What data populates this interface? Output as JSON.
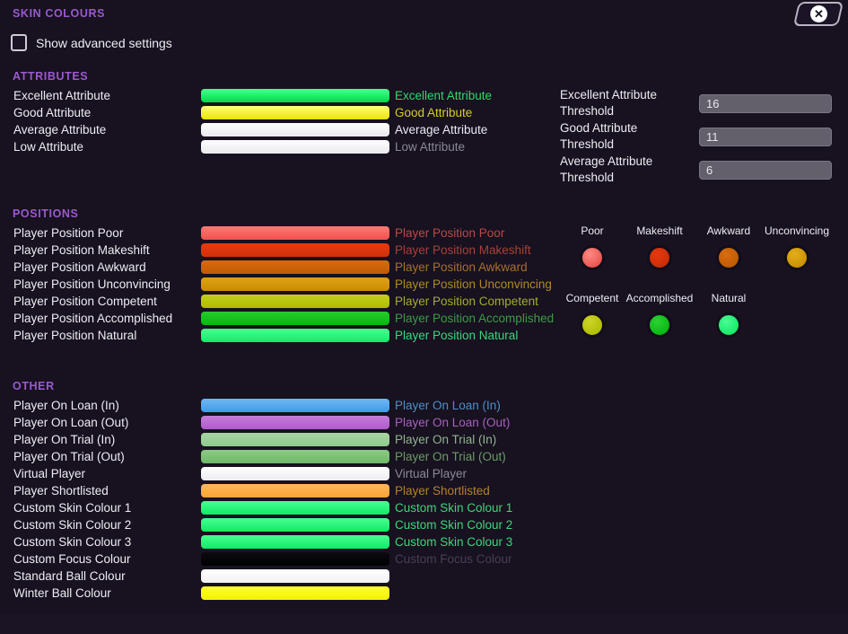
{
  "header": {
    "title": "SKIN COLOURS",
    "close_icon": "close-circle-icon",
    "close_glyph": "✕"
  },
  "advanced": {
    "label": "Show advanced settings",
    "checked": false
  },
  "sections": {
    "attributes": {
      "title": "ATTRIBUTES",
      "rows": [
        {
          "name": "Excellent Attribute",
          "sample": "Excellent Attribute",
          "swatch_top": "#48ff90",
          "swatch_bottom": "#00d94a",
          "text_color": "#31d96a"
        },
        {
          "name": "Good Attribute",
          "sample": "Good Attribute",
          "swatch_top": "#ffff7a",
          "swatch_bottom": "#ece400",
          "text_color": "#d6cf1f"
        },
        {
          "name": "Average Attribute",
          "sample": "Average Attribute",
          "swatch_top": "#ffffff",
          "swatch_bottom": "#e9e9ec",
          "text_color": "#eceaf0"
        },
        {
          "name": "Low Attribute",
          "sample": "Low Attribute",
          "swatch_top": "#ffffff",
          "swatch_bottom": "#e9e9ec",
          "text_color": "#8d8a93"
        }
      ],
      "thresholds": [
        {
          "label": "Excellent Attribute Threshold",
          "value": "16"
        },
        {
          "label": "Good Attribute Threshold",
          "value": "11"
        },
        {
          "label": "Average Attribute Threshold",
          "value": "6"
        }
      ]
    },
    "positions": {
      "title": "POSITIONS",
      "rows": [
        {
          "name": "Player Position Poor",
          "sample": "Player Position Poor",
          "swatch_top": "#ff7a75",
          "swatch_bottom": "#f2514c",
          "text_color": "#b94a44"
        },
        {
          "name": "Player Position Makeshift",
          "sample": "Player Position Makeshift",
          "swatch_top": "#e83a12",
          "swatch_bottom": "#cf3207",
          "text_color": "#a64236"
        },
        {
          "name": "Player Position Awkward",
          "sample": "Player Position Awkward",
          "swatch_top": "#d96a10",
          "swatch_bottom": "#c05c05",
          "text_color": "#a96f31"
        },
        {
          "name": "Player Position Unconvincing",
          "sample": "Player Position Unconvincing",
          "swatch_top": "#e0a215",
          "swatch_bottom": "#c88c02",
          "text_color": "#b08a22"
        },
        {
          "name": "Player Position Competent",
          "sample": "Player Position Competent",
          "swatch_top": "#c3cf1c",
          "swatch_bottom": "#b0bc00",
          "text_color": "#a4ac30"
        },
        {
          "name": "Player Position Accomplished",
          "sample": "Player Position Accomplished",
          "swatch_top": "#25cc2c",
          "swatch_bottom": "#06b80f",
          "text_color": "#3d9b45"
        },
        {
          "name": "Player Position Natural",
          "sample": "Player Position Natural",
          "swatch_top": "#48ff90",
          "swatch_bottom": "#16e86a",
          "text_color": "#3ad87a"
        }
      ],
      "circles": [
        {
          "label": "Poor",
          "color_top": "#ff8a84",
          "color_bottom": "#e8524c"
        },
        {
          "label": "Makeshift",
          "color_top": "#e8380f",
          "color_bottom": "#c72e05"
        },
        {
          "label": "Awkward",
          "color_top": "#d96c10",
          "color_bottom": "#bb5a02"
        },
        {
          "label": "Unconvincing",
          "color_top": "#e4ad1a",
          "color_bottom": "#c89000"
        },
        {
          "label": "Competent",
          "color_top": "#cdd42a",
          "color_bottom": "#b0bc00"
        },
        {
          "label": "Accomplished",
          "color_top": "#2bd134",
          "color_bottom": "#06b80f"
        },
        {
          "label": "Natural",
          "color_top": "#4bfb93",
          "color_bottom": "#12e868"
        }
      ]
    },
    "other": {
      "title": "OTHER",
      "rows": [
        {
          "name": "Player On Loan (In)",
          "sample": "Player On Loan (In)",
          "swatch_top": "#6fb8f2",
          "swatch_bottom": "#3f9ae8",
          "text_color": "#4e8fc4"
        },
        {
          "name": "Player On Loan (Out)",
          "sample": "Player On Loan (Out)",
          "swatch_top": "#c27fd8",
          "swatch_bottom": "#b258cd",
          "text_color": "#a861bd"
        },
        {
          "name": "Player On Trial (In)",
          "sample": "Player On Trial (In)",
          "swatch_top": "#a8d6a2",
          "swatch_bottom": "#8fc98c",
          "text_color": "#91b48c"
        },
        {
          "name": "Player On Trial (Out)",
          "sample": "Player On Trial (Out)",
          "swatch_top": "#8ccb85",
          "swatch_bottom": "#6eb868",
          "text_color": "#6c9a66"
        },
        {
          "name": "Virtual Player",
          "sample": "Virtual Player",
          "swatch_top": "#ffffff",
          "swatch_bottom": "#ececef",
          "text_color": "#8d8a93"
        },
        {
          "name": "Player Shortlisted",
          "sample": "Player Shortlisted",
          "swatch_top": "#ffb85c",
          "swatch_bottom": "#f9a333",
          "text_color": "#b5802e"
        },
        {
          "name": "Custom Skin Colour 1",
          "sample": "Custom Skin Colour 1",
          "swatch_top": "#48ff90",
          "swatch_bottom": "#12e868",
          "text_color": "#3ad87a"
        },
        {
          "name": "Custom Skin Colour 2",
          "sample": "Custom Skin Colour 2",
          "swatch_top": "#48ff90",
          "swatch_bottom": "#12e868",
          "text_color": "#3ad87a"
        },
        {
          "name": "Custom Skin Colour 3",
          "sample": "Custom Skin Colour 3",
          "swatch_top": "#48ff90",
          "swatch_bottom": "#12e868",
          "text_color": "#3ad87a"
        },
        {
          "name": "Custom Focus Colour",
          "sample": "Custom Focus Colour",
          "swatch_top": "#0c0a10",
          "swatch_bottom": "#000000",
          "text_color": "#4a3f52"
        },
        {
          "name": "Standard Ball Colour",
          "sample": "",
          "swatch_top": "#ffffff",
          "swatch_bottom": "#f2f2f4",
          "text_color": "#eceaf0"
        },
        {
          "name": "Winter Ball Colour",
          "sample": "",
          "swatch_top": "#ffff2e",
          "swatch_bottom": "#f2f200",
          "text_color": "#e8e800"
        }
      ]
    }
  }
}
